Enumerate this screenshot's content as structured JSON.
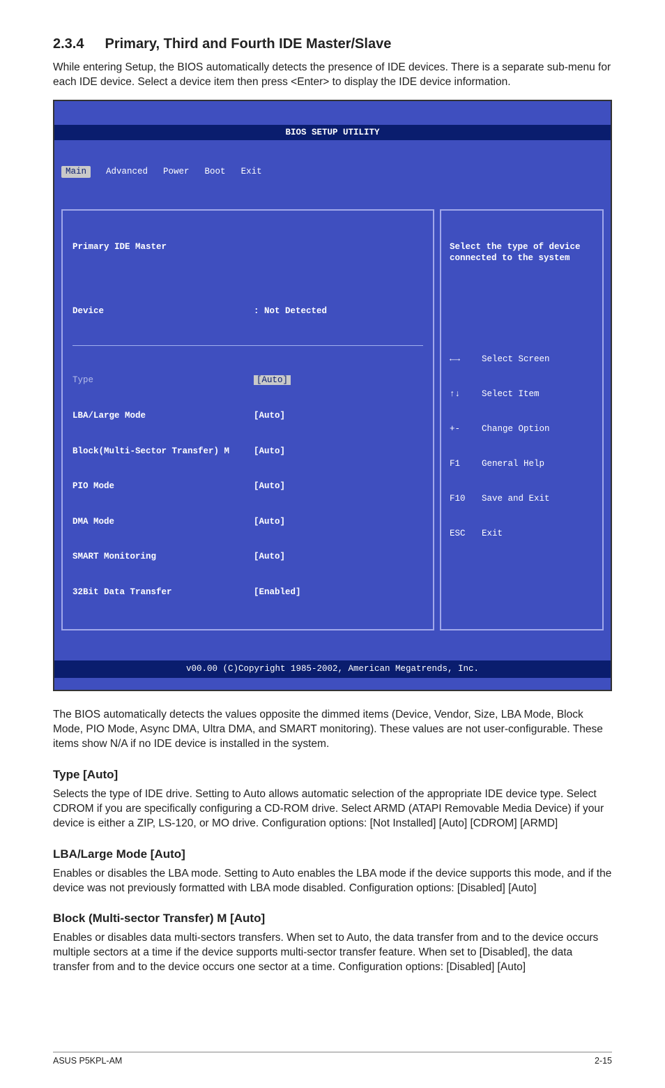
{
  "section": {
    "number": "2.3.4",
    "title": "Primary, Third and Fourth IDE Master/Slave"
  },
  "intro": "While entering Setup, the BIOS automatically detects the presence of IDE devices. There is a separate sub-menu for each IDE device. Select a device item then press <Enter> to display the IDE device information.",
  "bios": {
    "title": "BIOS SETUP UTILITY",
    "tabs": [
      "Main",
      "Advanced",
      "Power",
      "Boot",
      "Exit"
    ],
    "selected_tab": "Main",
    "header_line": "Primary IDE Master",
    "device_label": "Device",
    "device_value": ": Not Detected",
    "rows": [
      {
        "label": "Type",
        "value": "[Auto]",
        "highlight": true
      },
      {
        "label": "LBA/Large Mode",
        "value": "[Auto]"
      },
      {
        "label": "Block(Multi-Sector Transfer) M",
        "value": "[Auto]"
      },
      {
        "label": "PIO Mode",
        "value": "[Auto]"
      },
      {
        "label": "DMA Mode",
        "value": "[Auto]"
      },
      {
        "label": "SMART Monitoring",
        "value": "[Auto]"
      },
      {
        "label": "32Bit Data Transfer",
        "value": "[Enabled]"
      }
    ],
    "help_text": "Select the type of device connected to the system",
    "help_keys": [
      {
        "k": "←→",
        "t": "Select Screen"
      },
      {
        "k": "↑↓",
        "t": "Select Item"
      },
      {
        "k": "+-",
        "t": "Change Option"
      },
      {
        "k": "F1",
        "t": "General Help"
      },
      {
        "k": "F10",
        "t": "Save and Exit"
      },
      {
        "k": "ESC",
        "t": "Exit"
      }
    ],
    "footer": "v00.00 (C)Copyright 1985-2002, American Megatrends, Inc."
  },
  "after_bios": "The BIOS automatically detects the values opposite the dimmed items (Device, Vendor, Size, LBA Mode, Block Mode, PIO Mode, Async DMA, Ultra DMA, and SMART monitoring). These values are not user-configurable. These items show N/A if no IDE device is installed in the system.",
  "type_heading": "Type [Auto]",
  "type_body": "Selects the type of IDE drive. Setting to Auto allows automatic selection of the appropriate IDE device type. Select CDROM if you are specifically configuring a CD-ROM drive. Select ARMD (ATAPI Removable Media Device) if your device is either a ZIP, LS-120, or MO drive. Configuration options: [Not Installed] [Auto] [CDROM] [ARMD]",
  "lba_heading": "LBA/Large Mode [Auto]",
  "lba_body": "Enables or disables the LBA mode. Setting to Auto enables the LBA mode if the device supports this mode, and if the device was not previously formatted with LBA mode disabled. Configuration options: [Disabled] [Auto]",
  "block_heading": "Block (Multi-sector Transfer) M [Auto]",
  "block_body": "Enables or disables data multi-sectors transfers. When set to Auto, the data transfer from and to the device occurs multiple sectors at a time if the device supports multi-sector transfer feature. When set to [Disabled], the data transfer from and to the device occurs one sector at a time. Configuration options: [Disabled] [Auto]",
  "footer_left": "ASUS P5KPL-AM",
  "footer_right": "2-15"
}
